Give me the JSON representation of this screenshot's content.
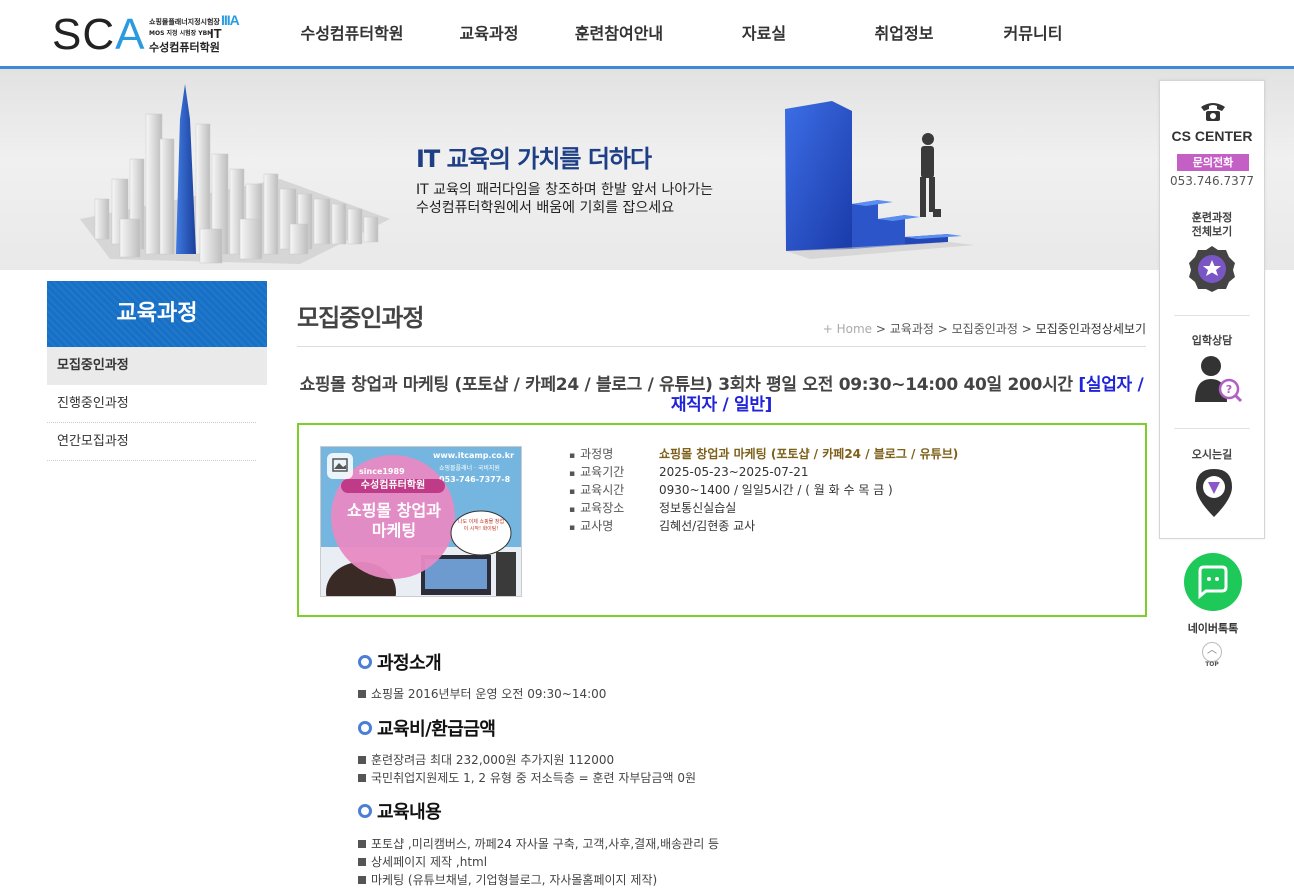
{
  "logo": {
    "text_prefix": "SC",
    "text_accent": "A",
    "line1": "쇼핑몰플래너지정시험장",
    "line1_mark": "IIIA",
    "line2": "MOS 지정 시험장 YBM",
    "line2_mark": "IT",
    "line3": "수성컴퓨터학원"
  },
  "nav": [
    "수성컴퓨터학원",
    "교육과정",
    "훈련참여안내",
    "자료실",
    "취업정보",
    "커뮤니티"
  ],
  "banner": {
    "title": "IT 교육의 가치를 더하다",
    "sub1": "IT 교육의 패러다임을 창조하며 한발 앞서 나아가는",
    "sub2": "수성컴퓨터학원에서 배움에 기회를 잡으세요"
  },
  "lnb": {
    "title": "교육과정",
    "items": [
      "모집중인과정",
      "진행중인과정",
      "연간모집과정"
    ]
  },
  "page_title": "모집중인과정",
  "breadcrumb": {
    "home": "+ Home",
    "sep": ">",
    "c1": "교육과정",
    "c2": "모집중인과정",
    "c3": "모집중인과정상세보기"
  },
  "course": {
    "title": "쇼핑몰 창업과 마케팅 (포토샵 / 카페24 / 블로그 / 유튜브) 3회차 평일 오전 09:30~14:00 40일 200시간",
    "tag": "[실업자 / 재직자 / 일반]",
    "info": [
      {
        "k": "과정명",
        "v": "쇼핑몰 창업과 마케팅 (포토샵 / 카페24 / 블로그 / 유튜브)"
      },
      {
        "k": "교육기간",
        "v": "2025-05-23~2025-07-21"
      },
      {
        "k": "교육시간",
        "v": "0930~1400 / 일일5시간 / ( 월 화 수 목 금 )"
      },
      {
        "k": "교육장소",
        "v": "정보통신실습실"
      },
      {
        "k": "교사명",
        "v": "김혜선/김현종 교사"
      }
    ]
  },
  "thumb": {
    "url": "www.itcamp.co.kr",
    "small": "쇼핑몰플래너 · 국비지원",
    "phone": "053-746-7377-8",
    "since": "since1989",
    "school": "수성컴퓨터학원",
    "course1": "쇼핑몰 창업과",
    "course2": "마케팅",
    "bubble": "나도 이제 쇼핑몰 창업이 시작! 화이팅!"
  },
  "sections": [
    {
      "h": "과정소개",
      "lines": [
        "쇼핑몰 2016년부터 운영 오전 09:30~14:00"
      ]
    },
    {
      "h": "교육비/환급금액",
      "lines": [
        "훈련장려금 최대 232,000원 추가지원 112000",
        "국민취업지원제도 1, 2 유형 중 저소득층 = 훈련 자부담금액 0원"
      ]
    },
    {
      "h": "교육내용",
      "lines": [
        "포토샵 ,미리캠버스, 까페24 자사몰 구축, 고객,사후,결재,배송관리 등",
        "상세페이지 제작 ,html",
        "마케팅 (유튜브채널, 기업형블로그, 자사몰홈페이지 제작)"
      ]
    }
  ],
  "quick": {
    "cs_center": "CS CENTER",
    "inquiry": "문의전화",
    "tel": "053.746.7377",
    "all_courses": "훈련과정\n전체보기",
    "all_courses_1": "훈련과정",
    "all_courses_2": "전체보기",
    "consult": "입학상담",
    "map": "오시는길",
    "naver_talk": "네이버톡톡",
    "top": "TOP"
  },
  "colors": {
    "accent_blue": "#3d8ad6",
    "lnb_blue": "#1670c6",
    "box_green": "#7ccf2a",
    "tag_blue": "#2024d8",
    "talk_green": "#1ec95a",
    "inquiry_purple": "#c45fc6"
  }
}
